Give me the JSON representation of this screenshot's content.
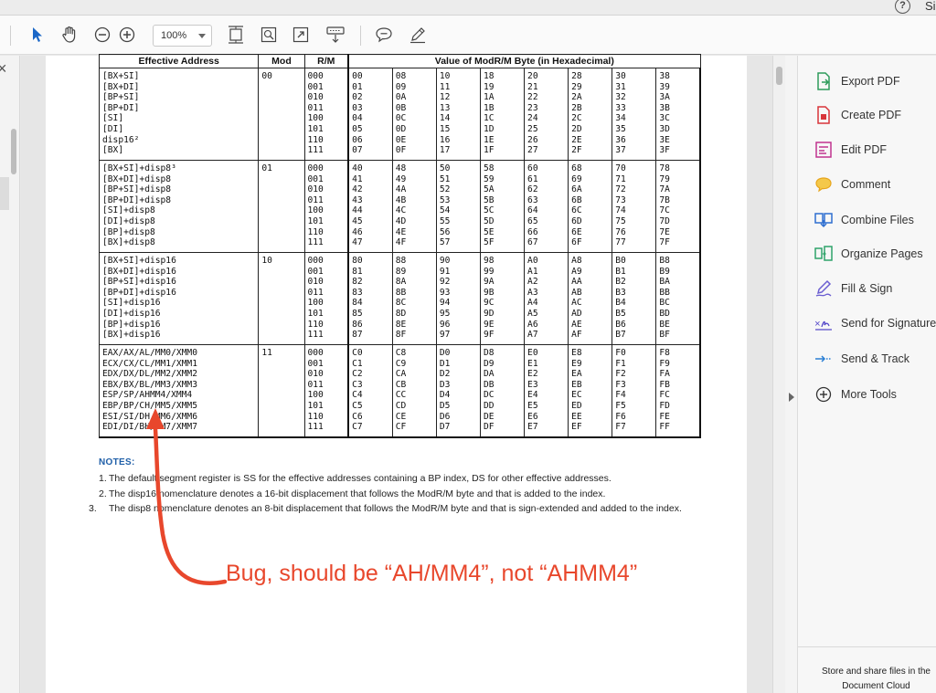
{
  "window": {
    "help_icon": "?",
    "top_right_label": "Si"
  },
  "toolbar": {
    "tools": [
      {
        "name": "select-arrow-icon"
      },
      {
        "name": "hand-icon"
      },
      {
        "name": "zoom-out-icon"
      },
      {
        "name": "zoom-in-icon"
      },
      {
        "name": "fit-page-icon"
      },
      {
        "name": "marquee-zoom-icon"
      },
      {
        "name": "full-screen-icon"
      },
      {
        "name": "keyboard-scroll-icon"
      },
      {
        "name": "comment-icon"
      },
      {
        "name": "pen-icon"
      }
    ],
    "zoom_value": "100%"
  },
  "table": {
    "headers": {
      "effective_address": "Effective Address",
      "mod": "Mod",
      "rm": "R/M",
      "value": "Value of ModR/M Byte (in Hexadecimal)"
    },
    "groups": [
      {
        "addresses": [
          "[BX+SI]",
          "[BX+DI]",
          "[BP+SI]",
          "[BP+DI]",
          "[SI]",
          "[DI]",
          "disp16²",
          "[BX]"
        ],
        "mod": "00",
        "rm": [
          "000",
          "001",
          "010",
          "011",
          "100",
          "101",
          "110",
          "111"
        ],
        "columns": [
          [
            "00",
            "01",
            "02",
            "03",
            "04",
            "05",
            "06",
            "07"
          ],
          [
            "08",
            "09",
            "0A",
            "0B",
            "0C",
            "0D",
            "0E",
            "0F"
          ],
          [
            "10",
            "11",
            "12",
            "13",
            "14",
            "15",
            "16",
            "17"
          ],
          [
            "18",
            "19",
            "1A",
            "1B",
            "1C",
            "1D",
            "1E",
            "1F"
          ],
          [
            "20",
            "21",
            "22",
            "23",
            "24",
            "25",
            "26",
            "27"
          ],
          [
            "28",
            "29",
            "2A",
            "2B",
            "2C",
            "2D",
            "2E",
            "2F"
          ],
          [
            "30",
            "31",
            "32",
            "33",
            "34",
            "35",
            "36",
            "37"
          ],
          [
            "38",
            "39",
            "3A",
            "3B",
            "3C",
            "3D",
            "3E",
            "3F"
          ]
        ]
      },
      {
        "addresses": [
          "[BX+SI]+disp8³",
          "[BX+DI]+disp8",
          "[BP+SI]+disp8",
          "[BP+DI]+disp8",
          "[SI]+disp8",
          "[DI]+disp8",
          "[BP]+disp8",
          "[BX]+disp8"
        ],
        "mod": "01",
        "rm": [
          "000",
          "001",
          "010",
          "011",
          "100",
          "101",
          "110",
          "111"
        ],
        "columns": [
          [
            "40",
            "41",
            "42",
            "43",
            "44",
            "45",
            "46",
            "47"
          ],
          [
            "48",
            "49",
            "4A",
            "4B",
            "4C",
            "4D",
            "4E",
            "4F"
          ],
          [
            "50",
            "51",
            "52",
            "53",
            "54",
            "55",
            "56",
            "57"
          ],
          [
            "58",
            "59",
            "5A",
            "5B",
            "5C",
            "5D",
            "5E",
            "5F"
          ],
          [
            "60",
            "61",
            "62",
            "63",
            "64",
            "65",
            "66",
            "67"
          ],
          [
            "68",
            "69",
            "6A",
            "6B",
            "6C",
            "6D",
            "6E",
            "6F"
          ],
          [
            "70",
            "71",
            "72",
            "73",
            "74",
            "75",
            "76",
            "77"
          ],
          [
            "78",
            "79",
            "7A",
            "7B",
            "7C",
            "7D",
            "7E",
            "7F"
          ]
        ]
      },
      {
        "addresses": [
          "[BX+SI]+disp16",
          "[BX+DI]+disp16",
          "[BP+SI]+disp16",
          "[BP+DI]+disp16",
          "[SI]+disp16",
          "[DI]+disp16",
          "[BP]+disp16",
          "[BX]+disp16"
        ],
        "mod": "10",
        "rm": [
          "000",
          "001",
          "010",
          "011",
          "100",
          "101",
          "110",
          "111"
        ],
        "columns": [
          [
            "80",
            "81",
            "82",
            "83",
            "84",
            "85",
            "86",
            "87"
          ],
          [
            "88",
            "89",
            "8A",
            "8B",
            "8C",
            "8D",
            "8E",
            "8F"
          ],
          [
            "90",
            "91",
            "92",
            "93",
            "94",
            "95",
            "96",
            "97"
          ],
          [
            "98",
            "99",
            "9A",
            "9B",
            "9C",
            "9D",
            "9E",
            "9F"
          ],
          [
            "A0",
            "A1",
            "A2",
            "A3",
            "A4",
            "A5",
            "A6",
            "A7"
          ],
          [
            "A8",
            "A9",
            "AA",
            "AB",
            "AC",
            "AD",
            "AE",
            "AF"
          ],
          [
            "B0",
            "B1",
            "B2",
            "B3",
            "B4",
            "B5",
            "B6",
            "B7"
          ],
          [
            "B8",
            "B9",
            "BA",
            "BB",
            "BC",
            "BD",
            "BE",
            "BF"
          ]
        ]
      },
      {
        "addresses": [
          "EAX/AX/AL/MM0/XMM0",
          "ECX/CX/CL/MM1/XMM1",
          "EDX/DX/DL/MM2/XMM2",
          "EBX/BX/BL/MM3/XMM3",
          "ESP/SP/AHMM4/XMM4",
          "EBP/BP/CH/MM5/XMM5",
          "ESI/SI/DH/MM6/XMM6",
          "EDI/DI/BH/MM7/XMM7"
        ],
        "mod": "11",
        "rm": [
          "000",
          "001",
          "010",
          "011",
          "100",
          "101",
          "110",
          "111"
        ],
        "columns": [
          [
            "C0",
            "C1",
            "C2",
            "C3",
            "C4",
            "C5",
            "C6",
            "C7"
          ],
          [
            "C8",
            "C9",
            "CA",
            "CB",
            "CC",
            "CD",
            "CE",
            "CF"
          ],
          [
            "D0",
            "D1",
            "D2",
            "D3",
            "D4",
            "D5",
            "D6",
            "D7"
          ],
          [
            "D8",
            "D9",
            "DA",
            "DB",
            "DC",
            "DD",
            "DE",
            "DF"
          ],
          [
            "E0",
            "E1",
            "E2",
            "E3",
            "E4",
            "E5",
            "E6",
            "E7"
          ],
          [
            "E8",
            "E9",
            "EA",
            "EB",
            "EC",
            "ED",
            "EE",
            "EF"
          ],
          [
            "F0",
            "F1",
            "F2",
            "F3",
            "F4",
            "F5",
            "F6",
            "F7"
          ],
          [
            "F8",
            "F9",
            "FA",
            "FB",
            "FC",
            "FD",
            "FE",
            "FF"
          ]
        ]
      }
    ]
  },
  "notes": {
    "title": "NOTES:",
    "items": [
      {
        "num": "1.",
        "text": "The default segment register is SS for the effective addresses containing a BP index, DS for other effective addresses."
      },
      {
        "num": "2.",
        "text": "The disp16 nomenclature denotes a 16-bit displacement that follows the ModR/M byte and that is added to the index."
      },
      {
        "num": "3.",
        "text": "The disp8 nomenclature denotes an 8-bit displacement that follows the ModR/M byte and that is sign-extended and added to the index."
      }
    ]
  },
  "annotation": {
    "text": "Bug, should be “AH/MM4”, not “AHMM4”",
    "color": "#e8472c"
  },
  "tools_pane": {
    "items": [
      {
        "label": "Export PDF",
        "icon": "export-pdf-icon",
        "color": "#2e9b5b"
      },
      {
        "label": "Create PDF",
        "icon": "create-pdf-icon",
        "color": "#d8353a"
      },
      {
        "label": "Edit PDF",
        "icon": "edit-pdf-icon",
        "color": "#c1348f"
      },
      {
        "label": "Comment",
        "icon": "comment-icon",
        "color": "#e7a51c"
      },
      {
        "label": "Combine Files",
        "icon": "combine-files-icon",
        "color": "#2f6fd0"
      },
      {
        "label": "Organize Pages",
        "icon": "organize-pages-icon",
        "color": "#2fa36a"
      },
      {
        "label": "Fill & Sign",
        "icon": "fill-sign-icon",
        "color": "#6b5ed1"
      },
      {
        "label": "Send for Signature",
        "icon": "send-signature-icon",
        "color": "#5548c9"
      },
      {
        "label": "Send & Track",
        "icon": "send-track-icon",
        "color": "#2a7fd4"
      },
      {
        "label": "More Tools",
        "icon": "more-tools-icon",
        "color": "#333333"
      }
    ],
    "cloud_message": "Store and share files in the Document Cloud"
  }
}
